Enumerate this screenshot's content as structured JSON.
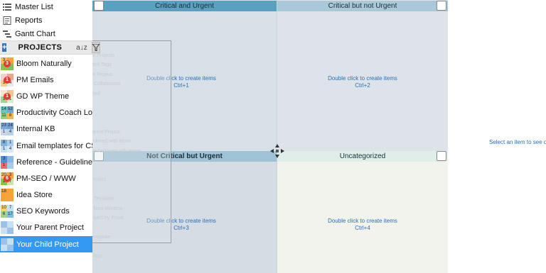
{
  "sidebar": {
    "nav": [
      {
        "label": "Master List",
        "icon": "list-icon"
      },
      {
        "label": "Reports",
        "icon": "reports-icon"
      },
      {
        "label": "Gantt Chart",
        "icon": "gantt-icon"
      }
    ],
    "projects_label": "PROJECTS",
    "sort_icon_text": "a↓z",
    "projects": [
      {
        "name": "Bloom Naturally",
        "thumb": [
          "3",
          "",
          "",
          ""
        ],
        "badge": "3",
        "colors": [
          "#f3c06a",
          "#f7a23e",
          "#8bc34a",
          "#7dc25a"
        ]
      },
      {
        "name": "PM Emails",
        "thumb": [
          "",
          "",
          "1",
          "4"
        ],
        "badge": "1",
        "colors": [
          "#f3d1d1",
          "#f0a58e",
          "#f5cf8a",
          "#e9e9e9"
        ]
      },
      {
        "name": "GD WP Theme",
        "thumb": [
          "",
          "",
          "1",
          "1"
        ],
        "badge": "1",
        "colors": [
          "#fbe3c7",
          "#f6c48c",
          "#9fd48e",
          "#d6efd0"
        ]
      },
      {
        "name": "Productivity Coach Logan",
        "thumb": [
          "14",
          "52",
          "11",
          "8"
        ],
        "badge": "",
        "colors": [
          "#66c7c0",
          "#6fa8dc",
          "#93d07c",
          "#f2b356"
        ]
      },
      {
        "name": "Internal KB",
        "thumb": [
          "23",
          "24",
          "1",
          "4"
        ],
        "badge": "",
        "colors": [
          "#7aa6d8",
          "#6f9fd3",
          "#c7d7ea",
          "#b7d4ec"
        ]
      },
      {
        "name": "Email templates for CS Te",
        "thumb": [
          "8",
          "1",
          "1",
          "4"
        ],
        "badge": "",
        "colors": [
          "#7bb3e0",
          "#a9cdef",
          "#c5ddf1",
          "#d8e8f5"
        ]
      },
      {
        "name": "Reference - Guidelines",
        "thumb": [
          "3",
          "",
          "1",
          ""
        ],
        "badge": "",
        "colors": [
          "#4f8fd6",
          "#8ab7e6",
          "#e66d6d",
          "#aac9ea"
        ]
      },
      {
        "name": "PM-SEO / WWW",
        "thumb": [
          "20",
          "3",
          "1",
          "7"
        ],
        "badge": "6",
        "colors": [
          "#f2c36f",
          "#f7a23e",
          "#8bc34a",
          "#cfe3a8"
        ]
      },
      {
        "name": "Idea Store",
        "thumb": [
          "18",
          "",
          "",
          ""
        ],
        "badge": "",
        "colors": [
          "#f6a33a",
          "#f6a33a",
          "#f6a33a",
          "#f6a33a"
        ]
      },
      {
        "name": "SEO Keywords",
        "thumb": [
          "10",
          "7",
          "6",
          "17"
        ],
        "badge": "",
        "colors": [
          "#f4d36b",
          "#bfe4f0",
          "#9dd58d",
          "#7bc0e0"
        ]
      },
      {
        "name": "Your Parent Project",
        "thumb": [
          "",
          "",
          "",
          ""
        ],
        "badge": "",
        "colors": [
          "#9cc3e6",
          "#c9dff2",
          "#c9dff2",
          "#9cc3e6"
        ]
      },
      {
        "name": "Your Child Project",
        "thumb": [
          "",
          "",
          "",
          ""
        ],
        "badge": "",
        "colors": [
          "#9cc3e6",
          "#c9dff2",
          "#c9dff2",
          "#9cc3e6"
        ],
        "selected": true
      }
    ]
  },
  "matrix": {
    "quadrants": [
      {
        "title": "Critical and Urgent",
        "hint": "Double click to create items",
        "shortcut": "Ctrl+1",
        "header_color": "#5aa0c0",
        "body_color": "#d7e0e6"
      },
      {
        "title": "Critical but not Urgent",
        "hint": "Double click to create items",
        "shortcut": "Ctrl+2",
        "header_color": "#a9c9d8",
        "body_color": "#dde3e8"
      },
      {
        "title": "Not Critical but Urgent",
        "hint": "Double click to create items",
        "shortcut": "Ctrl+3",
        "header_color": "#9ec2d6",
        "body_color": "#d5dde4"
      },
      {
        "title": "Uncategorized",
        "hint": "Double click to create items",
        "shortcut": "Ctrl+4",
        "header_color": "#dfeee9",
        "body_color": "#f1f3ec"
      }
    ]
  },
  "ghost_menu": {
    "items": [
      "",
      "Schedule Projects",
      "Add Parent Tags",
      "Duplicate Project",
      "Save as Collaborator",
      "Set Starred",
      "",
      "Modify",
      "",
      "Show Parent Project",
      "Show Archived with Items",
      "Show Not Archived with Items",
      "",
      "",
      "Delete Project",
      "",
      "Save as Template",
      "Open in New Window",
      "Send Project by Email",
      "",
      "Set as Template",
      "",
      "Project Tags",
      ""
    ]
  },
  "details": {
    "hint": "Select an item to see de"
  }
}
